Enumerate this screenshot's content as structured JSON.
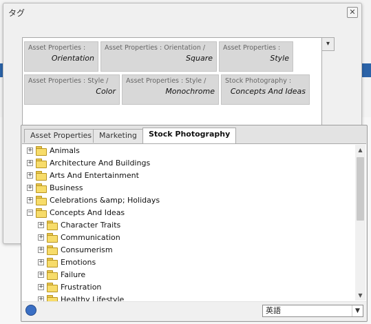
{
  "dialog": {
    "title": "タグ",
    "close_glyph": "✕",
    "dropdown_glyph": "▾"
  },
  "tags": [
    {
      "category": "Asset Properties :",
      "value": "Orientation"
    },
    {
      "category": "Asset Properties : Orientation /",
      "value": "Square"
    },
    {
      "category": "Asset Properties :",
      "value": "Style"
    },
    {
      "category": "Asset Properties : Style /",
      "value": "Color"
    },
    {
      "category": "Asset Properties : Style /",
      "value": "Monochrome"
    },
    {
      "category": "Stock Photography :",
      "value": "Concepts And Ideas"
    }
  ],
  "tabs": [
    {
      "label": "Asset Properties",
      "active": false
    },
    {
      "label": "Marketing",
      "active": false
    },
    {
      "label": "Stock Photography",
      "active": true
    }
  ],
  "tree": [
    {
      "label": "Animals",
      "expander": "+"
    },
    {
      "label": "Architecture And Buildings",
      "expander": "+"
    },
    {
      "label": "Arts And Entertainment",
      "expander": "+"
    },
    {
      "label": "Business",
      "expander": "+"
    },
    {
      "label": "Celebrations &amp; Holidays",
      "expander": "+"
    },
    {
      "label": "Concepts And Ideas",
      "expander": "−"
    },
    {
      "label": "Character Traits",
      "expander": "+"
    },
    {
      "label": "Communication",
      "expander": "+"
    },
    {
      "label": "Consumerism",
      "expander": "+"
    },
    {
      "label": "Emotions",
      "expander": "+"
    },
    {
      "label": "Failure",
      "expander": "+"
    },
    {
      "label": "Frustration",
      "expander": "+"
    },
    {
      "label": "Healthy Lifestyle",
      "expander": "+"
    }
  ],
  "scrollbar": {
    "up_glyph": "▲",
    "down_glyph": "▼"
  },
  "footer": {
    "language_value": "英語",
    "arrow_glyph": "▼"
  },
  "colors": {
    "folder": "#f7dc6a",
    "accent_strip": "#2b63a8",
    "tag_bg": "#d8d8d8"
  }
}
